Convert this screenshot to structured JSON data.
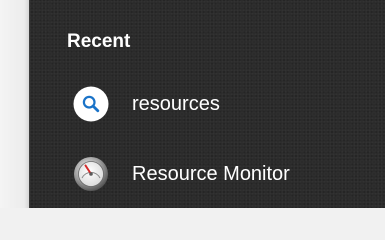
{
  "recent": {
    "title": "Recent",
    "items": [
      {
        "label": "resources",
        "icon": "search-icon"
      },
      {
        "label": "Resource Monitor",
        "icon": "resource-monitor-icon"
      }
    ]
  },
  "colors": {
    "panel_background": "#2b2b2b",
    "text": "#ffffff",
    "search_accent": "#1a73c8",
    "monitor_needle": "#d42a2a"
  }
}
